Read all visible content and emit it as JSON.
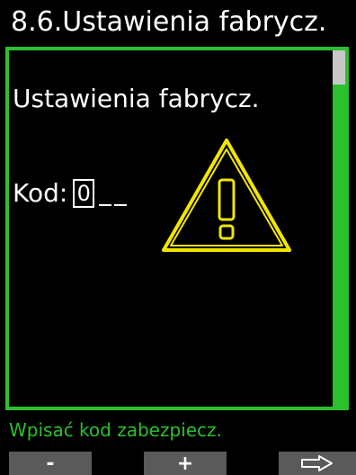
{
  "header": {
    "title": "8.6.Ustawienia fabrycz."
  },
  "main": {
    "heading": "Ustawienia fabrycz.",
    "code_label": "Kod:",
    "code_digit": "0",
    "warning_icon": "warning-triangle-icon"
  },
  "scrollbar": {
    "position": 0
  },
  "footer": {
    "hint": "Wpisać kod zabezpiecz.",
    "buttons": {
      "minus": "-",
      "plus": "+",
      "next_icon": "arrow-right-icon"
    }
  },
  "colors": {
    "accent_green": "#2cc02c",
    "warning_yellow": "#f2e600",
    "softkey_gray": "#5a5a5a"
  }
}
